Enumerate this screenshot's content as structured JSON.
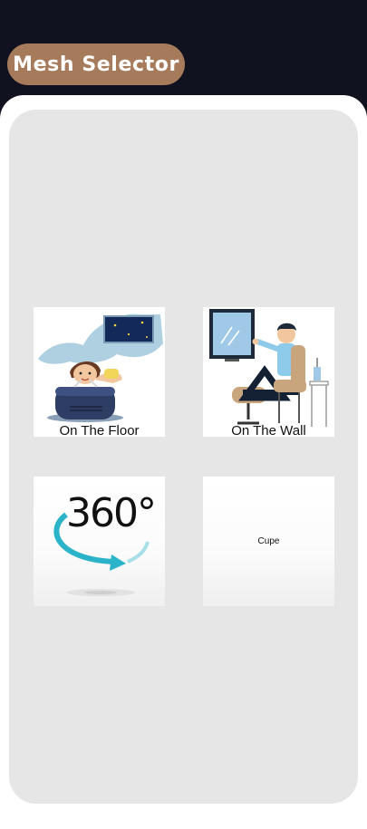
{
  "header": {
    "title": "Mesh Selector"
  },
  "options": [
    {
      "label": "On The Floor",
      "icon": "child-on-floor-illustration"
    },
    {
      "label": "On The Wall",
      "icon": "man-pointing-at-wall-screen-illustration"
    },
    {
      "label": "",
      "icon": "360-degree-rotation-icon",
      "image_text": "360°"
    },
    {
      "label": "Cupe",
      "icon": ""
    }
  ],
  "colors": {
    "background": "#11121f",
    "title_pill": "#a67b5b",
    "panel": "#ffffff",
    "inner_panel": "#e6e6e6",
    "accent_teal": "#2bb3c9"
  }
}
